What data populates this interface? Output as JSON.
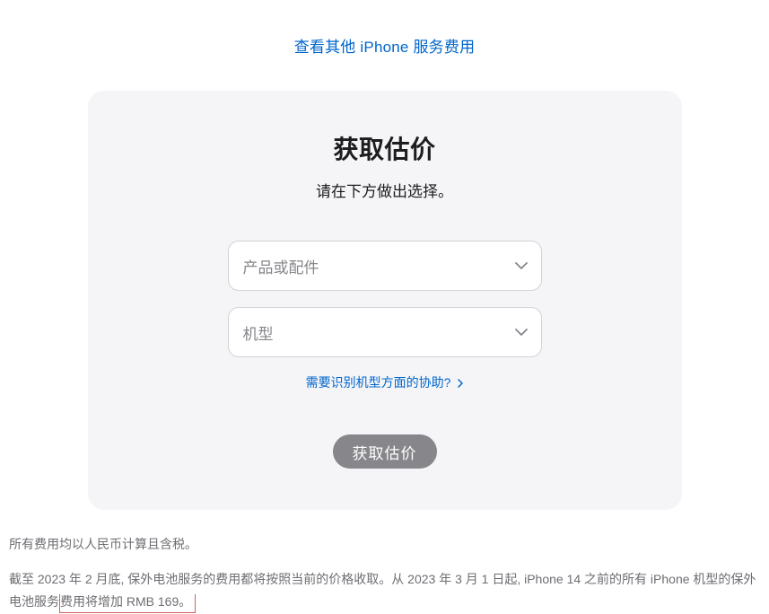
{
  "top_link": "查看其他 iPhone 服务费用",
  "card": {
    "title": "获取估价",
    "subtitle": "请在下方做出选择。",
    "product_placeholder": "产品或配件",
    "model_placeholder": "机型",
    "help_link": "需要识别机型方面的协助?",
    "button": "获取估价"
  },
  "footer": {
    "line1": "所有费用均以人民币计算且含税。",
    "line2_part1": "截至 2023 年 2 月底, 保外电池服务的费用都将按照当前的价格收取。从 2023 年 3 月 1 日起, iPhone 14 之前的所有 iPhone 机型的保外电池服务",
    "line2_highlight": "费用将增加 RMB 169。"
  }
}
